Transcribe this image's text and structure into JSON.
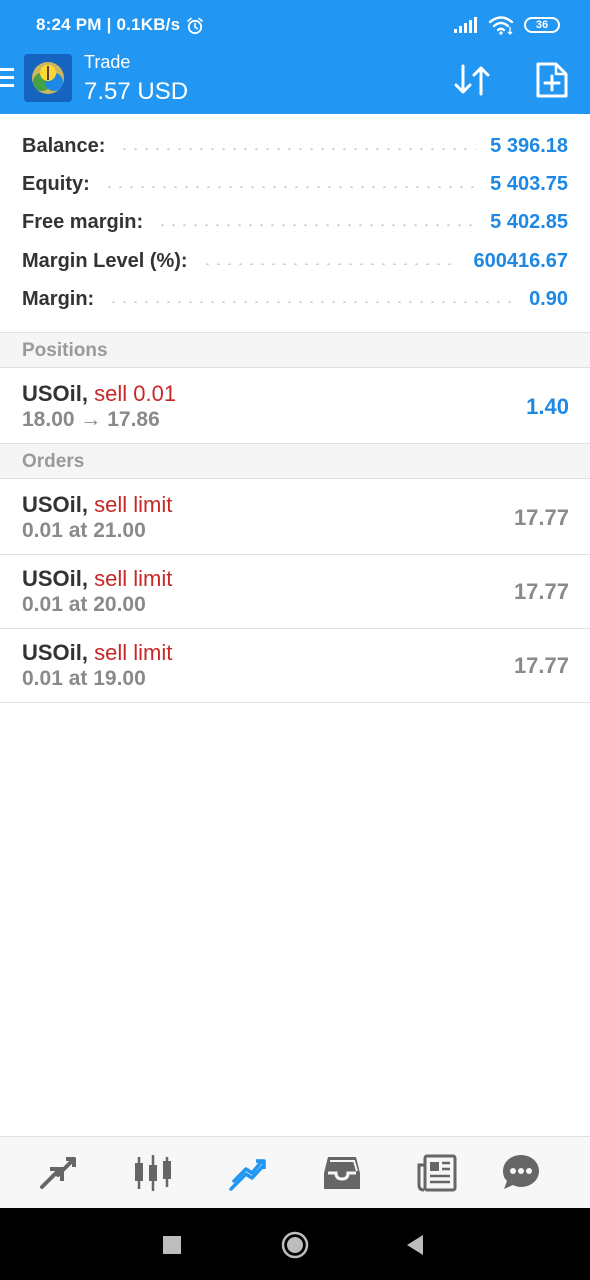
{
  "status_bar": {
    "time": "8:24 PM",
    "speed": "0.1KB/s",
    "battery": "36"
  },
  "header": {
    "title": "Trade",
    "subtitle": "7.57 USD",
    "icons": [
      "menu-icon",
      "app-logo-icon",
      "sort-icon",
      "new-order-icon"
    ]
  },
  "summary": {
    "balance": {
      "label": "Balance:",
      "value": "5 396.18"
    },
    "equity": {
      "label": "Equity:",
      "value": "5 403.75"
    },
    "free_margin": {
      "label": "Free margin:",
      "value": "5 402.85"
    },
    "margin_level": {
      "label": "Margin Level (%):",
      "value": "600416.67"
    },
    "margin": {
      "label": "Margin:",
      "value": "0.90"
    }
  },
  "positions": {
    "heading": "Positions",
    "items": [
      {
        "symbol": "USOil,",
        "side": "sell 0.01",
        "detail": "18.00 → 17.86",
        "profit": "1.40"
      }
    ]
  },
  "orders": {
    "heading": "Orders",
    "items": [
      {
        "symbol": "USOil,",
        "side": "sell limit",
        "detail": "0.01 at 21.00",
        "price": "17.77"
      },
      {
        "symbol": "USOil,",
        "side": "sell limit",
        "detail": "0.01 at 20.00",
        "price": "17.77"
      },
      {
        "symbol": "USOil,",
        "side": "sell limit",
        "detail": "0.01 at 19.00",
        "price": "17.77"
      }
    ]
  },
  "bottom_nav": {
    "items": [
      "quotes-icon",
      "chart-icon",
      "trade-icon",
      "history-icon",
      "news-icon",
      "chat-icon"
    ],
    "active": "trade-icon",
    "active_color": "#2196f3",
    "inactive_color": "#666666"
  },
  "colors": {
    "brand": "#2196f3",
    "value_blue": "#1e88e5",
    "sell_red": "#c62828"
  }
}
